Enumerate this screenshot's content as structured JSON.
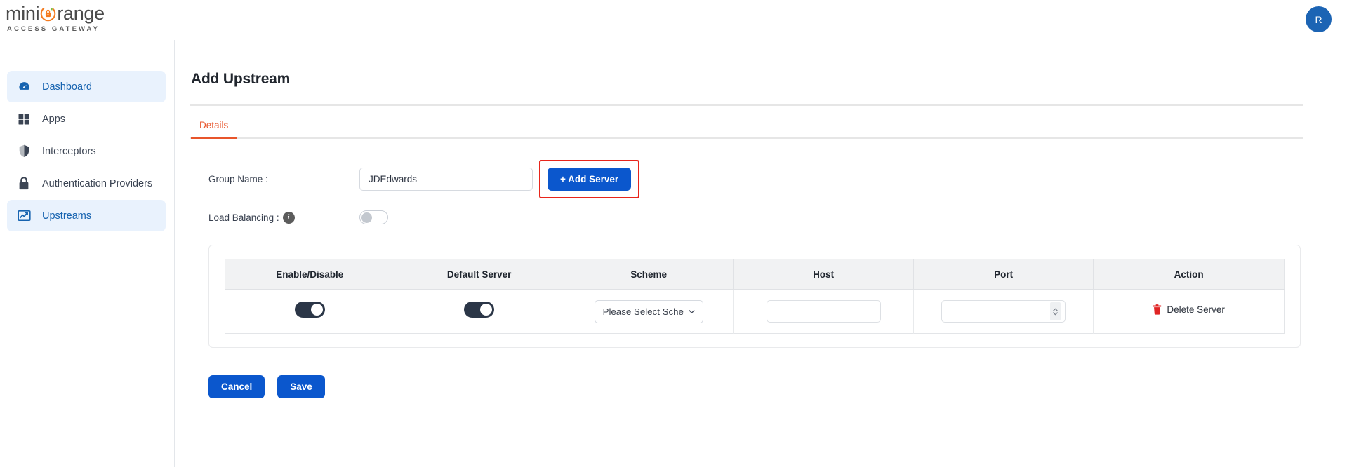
{
  "header": {
    "logo_main_pre": "mini",
    "logo_main_post": "range",
    "logo_sub": "ACCESS GATEWAY",
    "logo_icon": "orange-lock-circle-icon",
    "avatar_initial": "R",
    "avatar_color": "#1c64b4"
  },
  "sidebar": {
    "items": [
      {
        "label": "Dashboard",
        "icon": "dashboard-gauge-icon",
        "active": true
      },
      {
        "label": "Apps",
        "icon": "apps-grid-icon",
        "active": false
      },
      {
        "label": "Interceptors",
        "icon": "shield-icon",
        "active": false
      },
      {
        "label": "Authentication Providers",
        "icon": "lock-icon",
        "active": false
      },
      {
        "label": "Upstreams",
        "icon": "chart-line-icon",
        "active": true
      }
    ],
    "active_color": "#1663b0",
    "active_bg": "#e9f2fd"
  },
  "main": {
    "page_title": "Add Upstream",
    "tabs": [
      {
        "label": "Details",
        "active": true
      }
    ],
    "tab_accent": "#e8552b",
    "form": {
      "group_name_label": "Group Name :",
      "group_name_value": "JDEdwards",
      "add_server_label": "+ Add Server",
      "add_server_highlight_color": "#e8251b",
      "load_balancing_label": "Load Balancing :",
      "load_balancing_info_icon": "info-icon",
      "load_balancing_enabled": false
    },
    "table": {
      "columns": [
        "Enable/Disable",
        "Default Server",
        "Scheme",
        "Host",
        "Port",
        "Action"
      ],
      "rows": [
        {
          "enable_disable": true,
          "default_server": true,
          "scheme_value": "Please Select Schem",
          "scheme_full": "Please Select Scheme",
          "host_value": "",
          "host_placeholder": "",
          "port_value": "",
          "port_placeholder": "",
          "action_label": "Delete Server",
          "action_icon": "trash-icon",
          "action_color": "#e02424"
        }
      ]
    },
    "footer": {
      "cancel_label": "Cancel",
      "save_label": "Save",
      "button_color": "#0b57cd"
    }
  }
}
